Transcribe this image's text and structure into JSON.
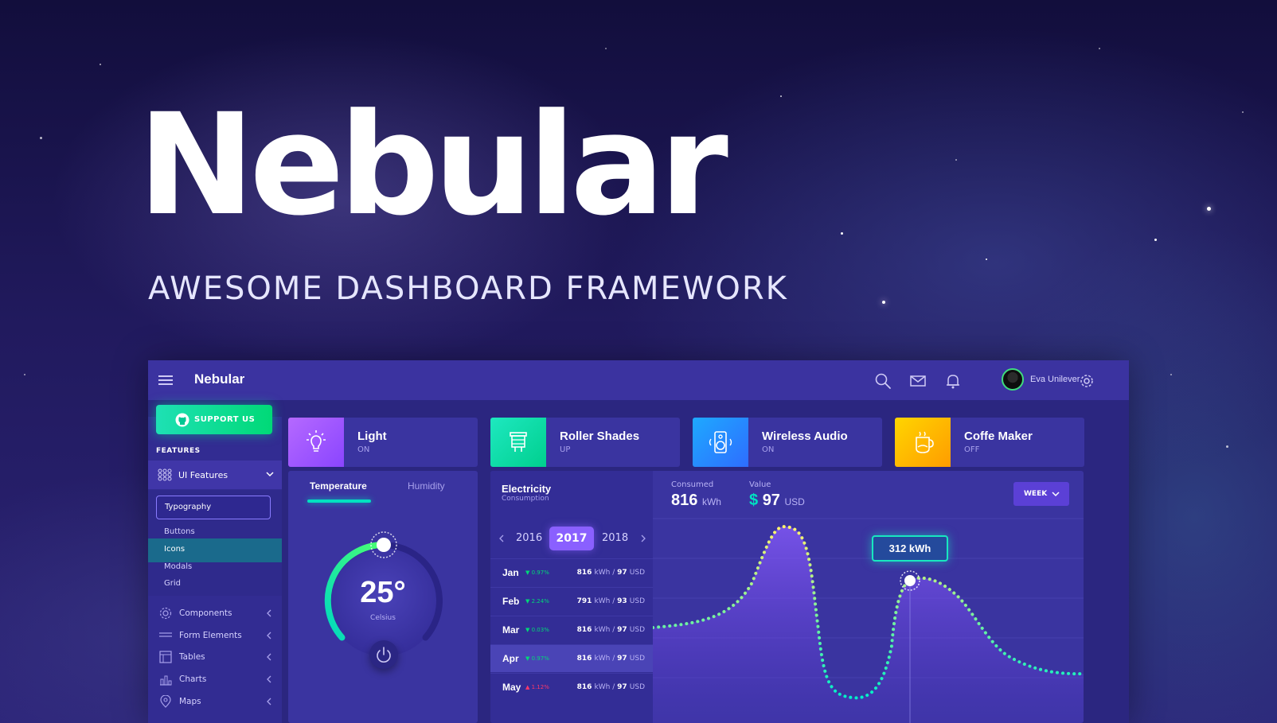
{
  "hero": {
    "title": "Nebular",
    "subtitle": "AWESOME DASHBOARD FRAMEWORK"
  },
  "header": {
    "brand": "Nebular",
    "user_name": "Eva Unilever",
    "icons": [
      "menu-icon",
      "search-icon",
      "mail-icon",
      "bell-icon",
      "settings-icon"
    ]
  },
  "sidebar": {
    "support_label": "SUPPORT US",
    "features_label": "FEATURES",
    "ui_features_label": "UI Features",
    "typography_label": "Typography",
    "sub_items": [
      "Buttons",
      "Icons",
      "Modals",
      "Grid"
    ],
    "active_sub_item": "Icons",
    "nav_items": [
      {
        "label": "Components",
        "icon": "components-icon"
      },
      {
        "label": "Form Elements",
        "icon": "form-icon"
      },
      {
        "label": "Tables",
        "icon": "table-icon"
      },
      {
        "label": "Charts",
        "icon": "chart-icon"
      },
      {
        "label": "Maps",
        "icon": "map-icon"
      }
    ]
  },
  "devices": [
    {
      "title": "Light",
      "status": "ON",
      "icon": "lightbulb-icon",
      "color": "#a156ff"
    },
    {
      "title": "Roller Shades",
      "status": "UP",
      "icon": "roller-shades-icon",
      "color": "#00d9a3"
    },
    {
      "title": "Wireless Audio",
      "status": "ON",
      "icon": "speaker-icon",
      "color": "#0088ff"
    },
    {
      "title": "Coffe Maker",
      "status": "OFF",
      "icon": "coffee-maker-icon",
      "color": "#ffb000"
    }
  ],
  "temperature": {
    "tab_active": "Temperature",
    "tab_inactive": "Humidity",
    "value": "25°",
    "unit": "Celsius"
  },
  "electricity": {
    "title": "Electricity",
    "subtitle": "Consumption",
    "years": [
      "2016",
      "2017",
      "2018"
    ],
    "selected_year": "2017",
    "months": [
      {
        "name": "Jan",
        "delta": "0.97%",
        "dir": "down",
        "kwh": "816",
        "usd": "97"
      },
      {
        "name": "Feb",
        "delta": "2.24%",
        "dir": "down",
        "kwh": "791",
        "usd": "93"
      },
      {
        "name": "Mar",
        "delta": "0.03%",
        "dir": "down",
        "kwh": "816",
        "usd": "97"
      },
      {
        "name": "Apr",
        "delta": "0.97%",
        "dir": "down",
        "kwh": "816",
        "usd": "97"
      },
      {
        "name": "May",
        "delta": "1.12%",
        "dir": "up",
        "kwh": "816",
        "usd": "97"
      }
    ],
    "active_month": "Apr",
    "unit_kwh": "kWh",
    "unit_usd": "USD",
    "consumed_label": "Consumed",
    "consumed_value": "816",
    "consumed_unit": "kWh",
    "value_label": "Value",
    "value_currency": "$",
    "value_amount": "97",
    "value_unit": "USD",
    "period": "WEEK",
    "tooltip": "312 kWh"
  },
  "colors": {
    "accent": "#00e1c1",
    "primary": "#8a60ff",
    "down": "#00d977",
    "up": "#ff386a"
  }
}
